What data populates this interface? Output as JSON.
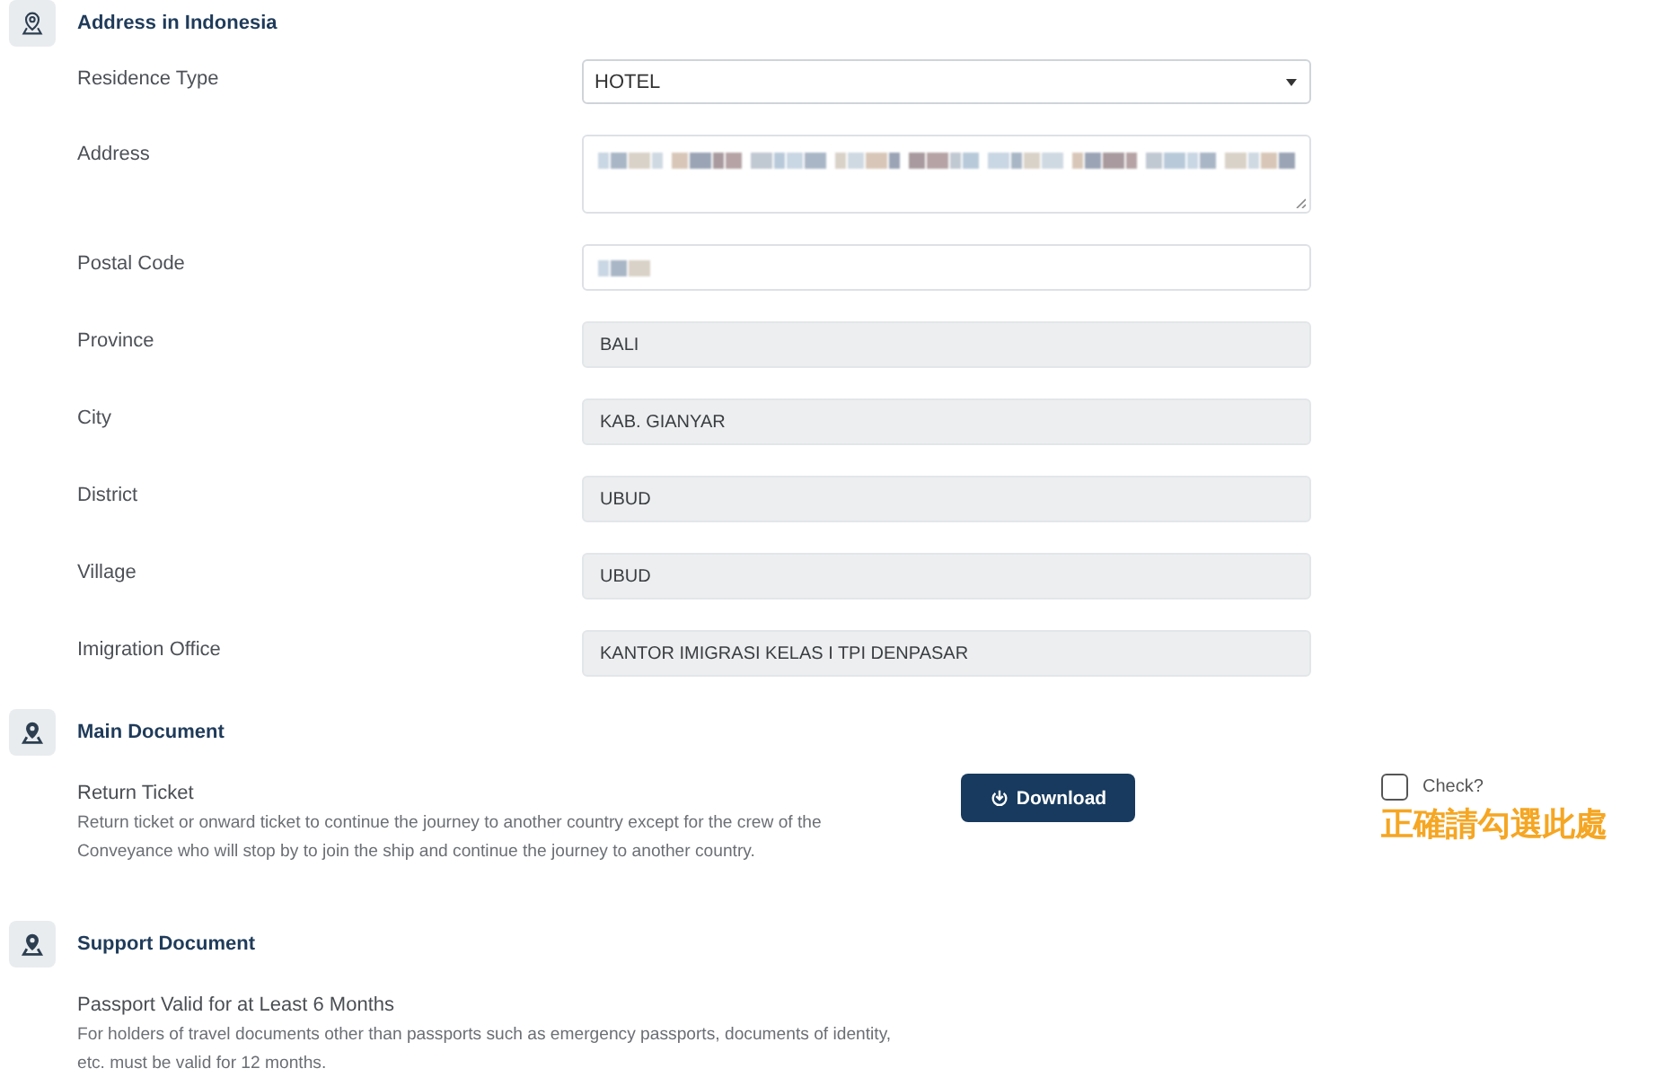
{
  "sections": [
    {
      "title": "Address in Indonesia",
      "fields": [
        {
          "label": "Residence Type",
          "kind": "select",
          "value": "HOTEL"
        },
        {
          "label": "Address",
          "kind": "textarea",
          "redacted": true
        },
        {
          "label": "Postal Code",
          "kind": "text",
          "redacted": true
        },
        {
          "label": "Province",
          "kind": "readonly",
          "value": "BALI"
        },
        {
          "label": "City",
          "kind": "readonly",
          "value": "KAB. GIANYAR"
        },
        {
          "label": "District",
          "kind": "readonly",
          "value": "UBUD"
        },
        {
          "label": "Village",
          "kind": "readonly",
          "value": "UBUD"
        },
        {
          "label": "Imigration Office",
          "kind": "readonly",
          "value": "KANTOR IMIGRASI KELAS I TPI DENPASAR"
        }
      ]
    },
    {
      "title": "Main Document",
      "documents": [
        {
          "title": "Return Ticket",
          "description": "Return ticket or onward ticket to continue the journey to another country except for the crew of the Conveyance who will stop by to join the ship and continue the journey to another country.",
          "button": "Download",
          "check": {
            "label": "Check?",
            "checked": false
          },
          "annotation": "正確請勾選此處"
        }
      ]
    },
    {
      "title": "Support Document",
      "documents": [
        {
          "title": "Passport Valid for at Least 6 Months",
          "description": "For holders of travel documents other than passports such as emergency passports, documents of identity, etc. must be valid for 12 months."
        }
      ]
    }
  ]
}
